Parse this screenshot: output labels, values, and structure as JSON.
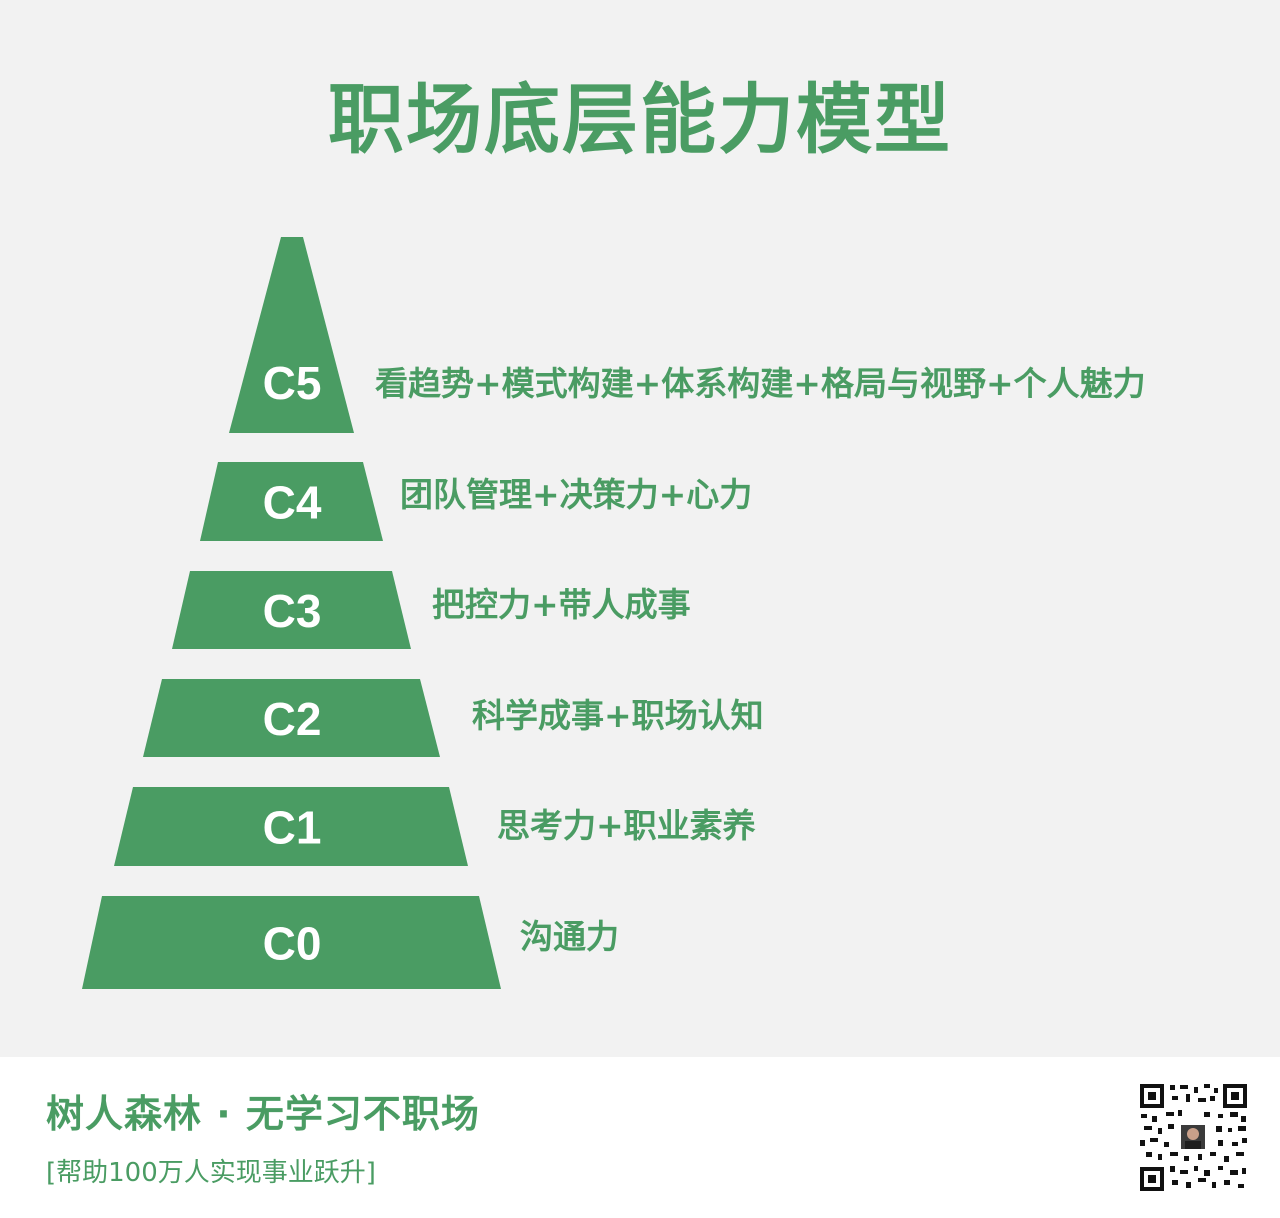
{
  "title": "职场底层能力模型",
  "levels": [
    {
      "label": "C5",
      "text": "看趋势+模式构建+体系构建+格局与视野+个人魅力"
    },
    {
      "label": "C4",
      "text": "团队管理+决策力+心力"
    },
    {
      "label": "C3",
      "text": "把控力+带人成事"
    },
    {
      "label": "C2",
      "text": "科学成事+职场认知"
    },
    {
      "label": "C1",
      "text": "思考力+职业素养"
    },
    {
      "label": "C0",
      "text": "沟通力"
    }
  ],
  "footer": {
    "brand": "树人森林 · 无学习不职场",
    "tagline": "[帮助100万人实现事业跃升]",
    "qr_icon": "qr-code-with-avatar"
  },
  "colors": {
    "accent": "#4a9c63",
    "background": "#f2f2f2",
    "footer": "#ffffff"
  }
}
